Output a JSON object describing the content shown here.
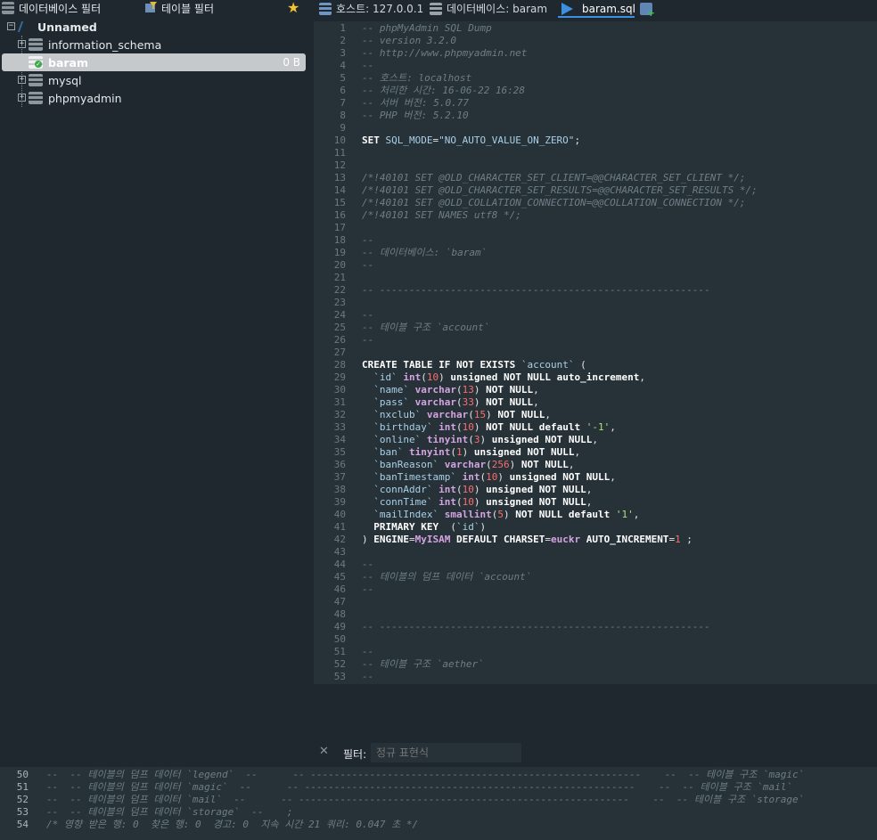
{
  "filterbar": {
    "db_filter_label": "데이터베이스 필터",
    "table_filter_label": "테이블 필터"
  },
  "tree": {
    "server": "Unnamed",
    "databases": [
      {
        "name": "information_schema",
        "size": ""
      },
      {
        "name": "baram",
        "size": "0 B"
      },
      {
        "name": "mysql",
        "size": ""
      },
      {
        "name": "phpmyadmin",
        "size": ""
      }
    ]
  },
  "tabs": [
    {
      "label": "호스트: 127.0.0.1",
      "icon": "server-icon"
    },
    {
      "label": "데이터베이스: baram",
      "icon": "database-icon"
    },
    {
      "label": "baram.sql",
      "icon": "query-play-icon",
      "active": true
    }
  ],
  "editor": {
    "line_numbers": [
      "1",
      "2",
      "3",
      "4",
      "5",
      "6",
      "7",
      "8",
      "9",
      "10",
      "11",
      "12",
      "13",
      "14",
      "15",
      "16",
      "17",
      "18",
      "19",
      "20",
      "21",
      "22",
      "23",
      "24",
      "25",
      "26",
      "27",
      "28",
      "29",
      "30",
      "31",
      "32",
      "33",
      "34",
      "35",
      "36",
      "37",
      "38",
      "39",
      "40",
      "41",
      "42",
      "43",
      "44",
      "45",
      "46",
      "47",
      "48",
      "49",
      "50",
      "51",
      "52",
      "53"
    ],
    "lines": [
      "-- phpMyAdmin SQL Dump",
      "-- version 3.2.0",
      "-- http://www.phpmyadmin.net",
      "--",
      "-- 호스트: localhost",
      "-- 처리한 시간: 16-06-22 16:28",
      "-- 서버 버전: 5.0.77",
      "-- PHP 버전: 5.2.10",
      "",
      "SET SQL_MODE=\"NO_AUTO_VALUE_ON_ZERO\";",
      "",
      "",
      "/*!40101 SET @OLD_CHARACTER_SET_CLIENT=@@CHARACTER_SET_CLIENT */;",
      "/*!40101 SET @OLD_CHARACTER_SET_RESULTS=@@CHARACTER_SET_RESULTS */;",
      "/*!40101 SET @OLD_COLLATION_CONNECTION=@@COLLATION_CONNECTION */;",
      "/*!40101 SET NAMES utf8 */;",
      "",
      "--",
      "-- 데이터베이스: `baram`",
      "--",
      "",
      "-- --------------------------------------------------------",
      "",
      "--",
      "-- 테이블 구조 `account`",
      "--",
      "",
      "CREATE TABLE IF NOT EXISTS `account` (",
      "  `id` int(10) unsigned NOT NULL auto_increment,",
      "  `name` varchar(13) NOT NULL,",
      "  `pass` varchar(33) NOT NULL,",
      "  `nxclub` varchar(15) NOT NULL,",
      "  `birthday` int(10) NOT NULL default '-1',",
      "  `online` tinyint(3) unsigned NOT NULL,",
      "  `ban` tinyint(1) unsigned NOT NULL,",
      "  `banReason` varchar(256) NOT NULL,",
      "  `banTimestamp` int(10) unsigned NOT NULL,",
      "  `connAddr` int(10) unsigned NOT NULL,",
      "  `connTime` int(10) unsigned NOT NULL,",
      "  `mailIndex` smallint(5) NOT NULL default '1',",
      "  PRIMARY KEY  (`id`)",
      ") ENGINE=MyISAM DEFAULT CHARSET=euckr AUTO_INCREMENT=1 ;",
      "",
      "--",
      "-- 테이블의 덤프 데이터 `account`",
      "--",
      "",
      "",
      "-- --------------------------------------------------------",
      "",
      "--",
      "-- 테이블 구조 `aether`",
      "--"
    ]
  },
  "filter": {
    "label": "필터:",
    "placeholder": "정규 표현식"
  },
  "log": {
    "line_numbers": [
      "50",
      "51",
      "52",
      "53",
      "54"
    ],
    "lines": [
      "--  -- 테이블의 덤프 데이터 `legend`  --      -- --------------------------------------------------------    --  -- 테이블 구조 `magic`",
      "--  -- 테이블의 덤프 데이터 `magic`  --      -- --------------------------------------------------------    --  -- 테이블 구조 `mail`",
      "--  -- 테이블의 덤프 데이터 `mail`  --      -- --------------------------------------------------------    --  -- 테이블 구조 `storage`",
      "--  -- 테이블의 덤프 데이터 `storage`  --    ;",
      "/* 영향 받은 행: 0  찾은 행: 0  경고: 0  지속 시간 21 쿼리: 0.047 초 */"
    ]
  },
  "colors": {
    "background": "#1f282e",
    "editor_bg": "#263138",
    "comment": "#6f7d86",
    "keyword": "#ffffff",
    "identifier": "#a9d0e8",
    "type": "#d6a3e2",
    "number": "#ff6c6c",
    "string": "#ade07a",
    "accent": "#3d8fe0",
    "selection": "#c5c9cc"
  }
}
